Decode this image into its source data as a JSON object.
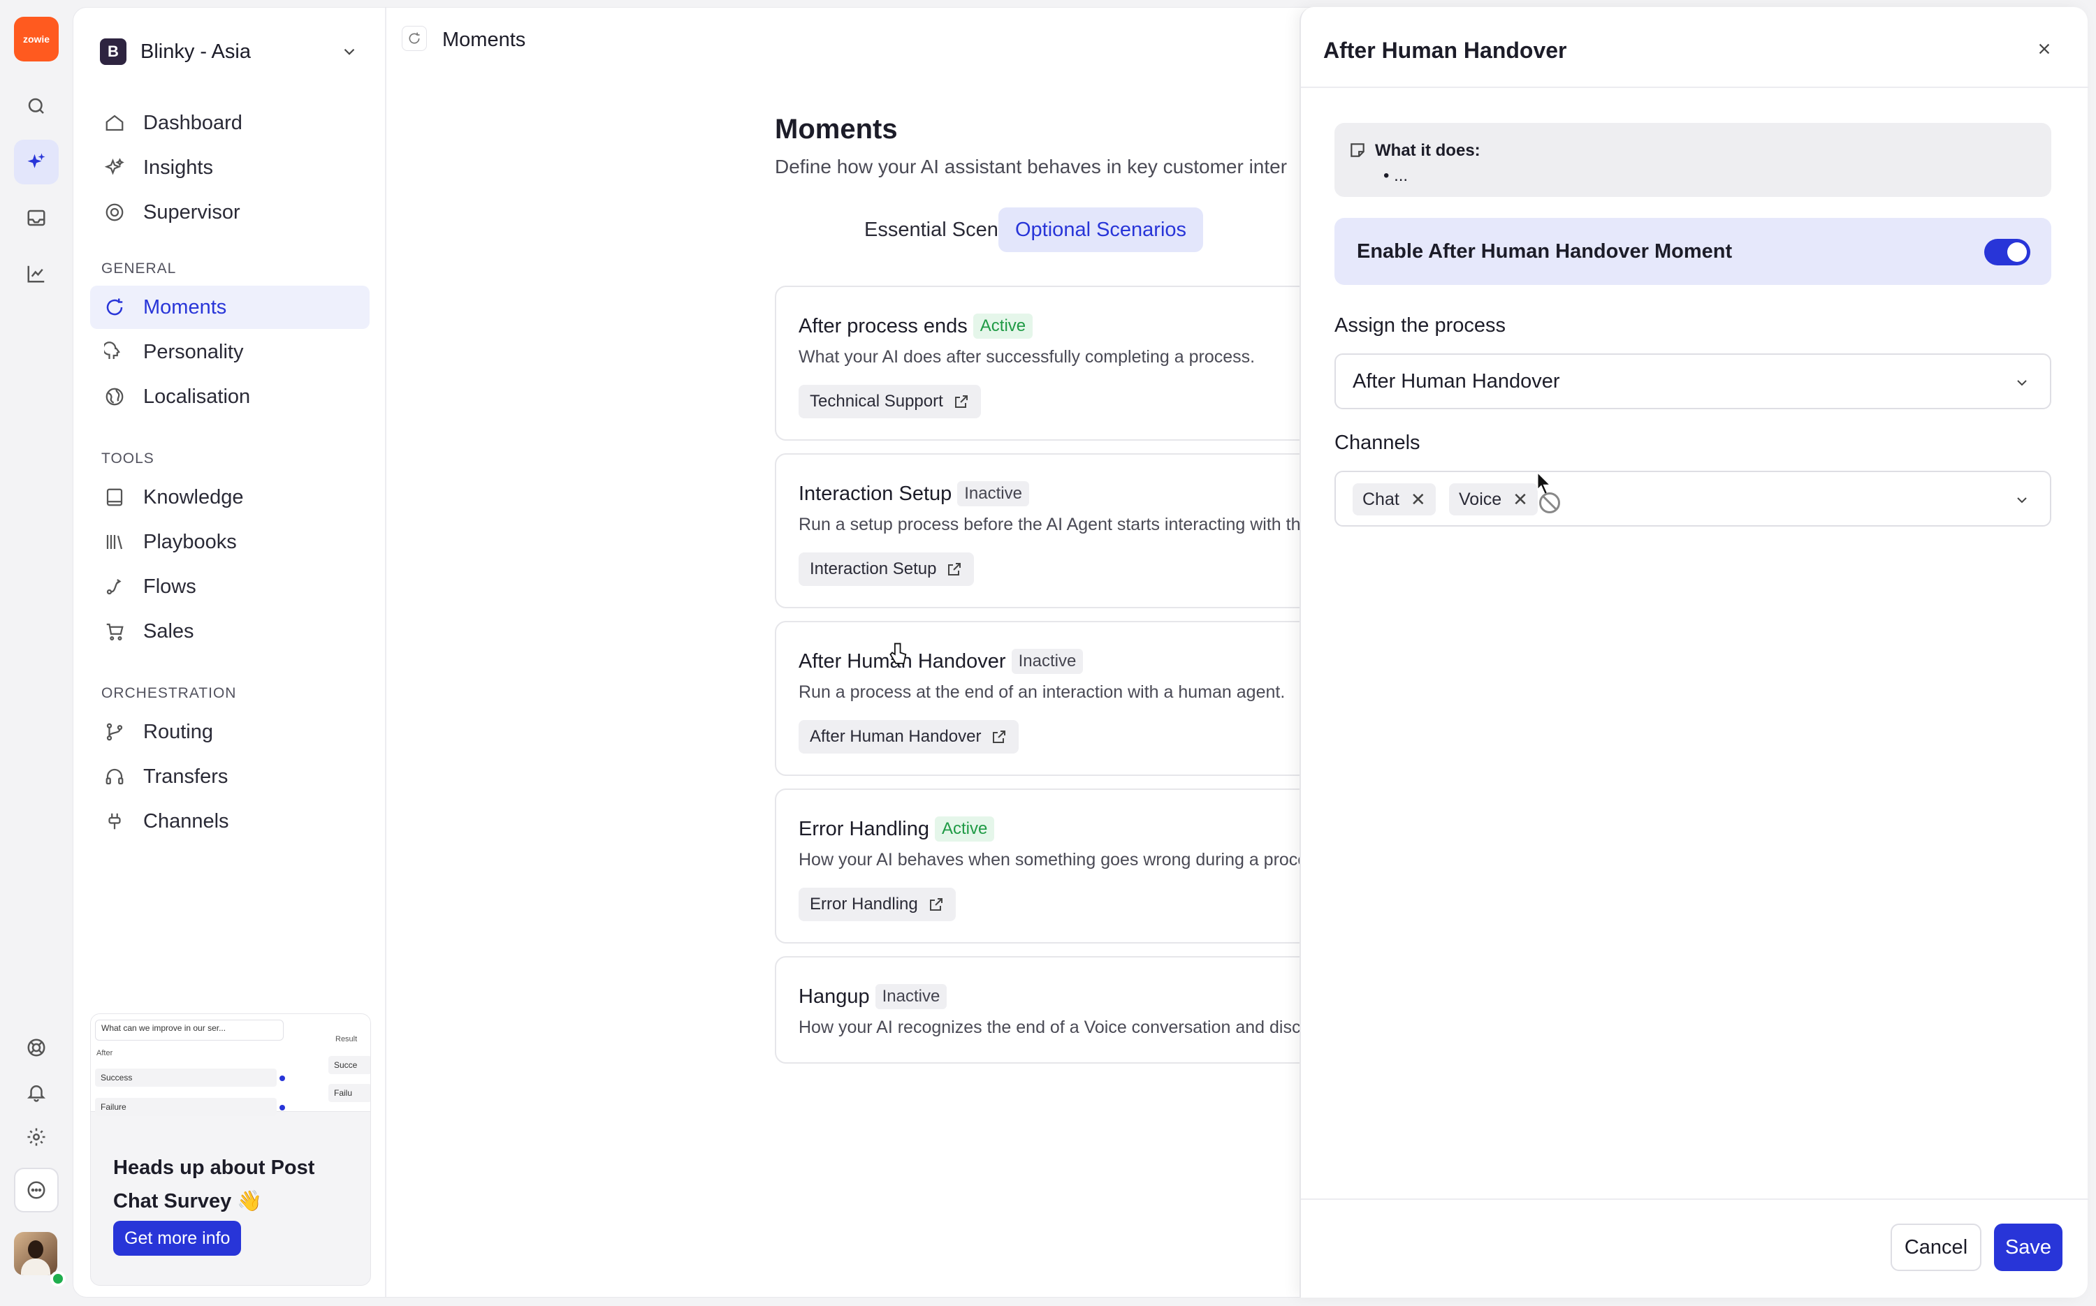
{
  "brand": {
    "logo_text": "zowie",
    "accent": "#2835d8",
    "logo_color": "#ff5a1f"
  },
  "rail": {
    "items": [
      {
        "name": "search-icon"
      },
      {
        "name": "sparkle-icon",
        "active": true
      },
      {
        "name": "inbox-icon"
      },
      {
        "name": "chart-icon"
      }
    ],
    "bottom": [
      {
        "name": "lifebuoy-icon"
      },
      {
        "name": "bell-icon"
      },
      {
        "name": "gear-icon"
      },
      {
        "name": "chat-icon"
      }
    ]
  },
  "workspace": {
    "initial": "B",
    "name": "Blinky - Asia"
  },
  "sidebar": {
    "top_items": [
      {
        "label": "Dashboard",
        "icon": "home-icon"
      },
      {
        "label": "Insights",
        "icon": "sparkle-icon"
      },
      {
        "label": "Supervisor",
        "icon": "supervisor-icon"
      }
    ],
    "general_title": "GENERAL",
    "general_items": [
      {
        "label": "Moments",
        "icon": "refresh-icon",
        "active": true
      },
      {
        "label": "Personality",
        "icon": "personality-icon"
      },
      {
        "label": "Localisation",
        "icon": "globe-icon"
      }
    ],
    "tools_title": "TOOLS",
    "tools_items": [
      {
        "label": "Knowledge",
        "icon": "book-icon"
      },
      {
        "label": "Playbooks",
        "icon": "library-icon"
      },
      {
        "label": "Flows",
        "icon": "flow-icon"
      },
      {
        "label": "Sales",
        "icon": "cart-icon"
      }
    ],
    "orchestration_title": "ORCHESTRATION",
    "orchestration_items": [
      {
        "label": "Routing",
        "icon": "branch-icon"
      },
      {
        "label": "Transfers",
        "icon": "headset-icon"
      },
      {
        "label": "Channels",
        "icon": "plug-icon"
      }
    ]
  },
  "promo": {
    "preview_question": "What can we improve in our ser...",
    "preview_after": "After",
    "preview_success": "Success",
    "preview_failure": "Failure",
    "preview_result": "Result",
    "preview_result_success": "Succe",
    "preview_result_failure": "Failu",
    "title": "Heads up about Post Chat Survey 👋",
    "button": "Get more info"
  },
  "header": {
    "title": "Moments"
  },
  "content": {
    "title": "Moments",
    "subtitle": "Define how your AI assistant behaves in key customer inter",
    "tabs": [
      {
        "label": "Essential Scenarios",
        "active": false
      },
      {
        "label": "Optional Scenarios",
        "active": true
      }
    ],
    "cards": [
      {
        "title": "After process ends",
        "status": "Active",
        "desc": "What your AI does after successfully completing a process.",
        "chip": "Technical Support"
      },
      {
        "title": "Interaction Setup",
        "status": "Inactive",
        "desc": "Run a setup process before the AI Agent starts interacting with th",
        "chip": "Interaction Setup"
      },
      {
        "title": "After Human Handover",
        "status": "Inactive",
        "desc": "Run a process at the end of an interaction with a human agent.",
        "chip": "After Human Handover"
      },
      {
        "title": "Error Handling",
        "status": "Active",
        "desc": "How your AI behaves when something goes wrong during a proce",
        "chip": "Error Handling"
      },
      {
        "title": "Hangup",
        "status": "Inactive",
        "desc": "How your AI recognizes the end of a Voice conversation and disc",
        "chip": ""
      }
    ]
  },
  "drawer": {
    "title": "After Human Handover",
    "info_title": "What it does:",
    "info_bullet": "• ...",
    "toggle_label": "Enable After Human Handover Moment",
    "toggle_on": true,
    "process_label": "Assign the process",
    "process_value": "After Human Handover",
    "channels_label": "Channels",
    "channels": [
      "Chat",
      "Voice"
    ],
    "cancel": "Cancel",
    "save": "Save"
  }
}
